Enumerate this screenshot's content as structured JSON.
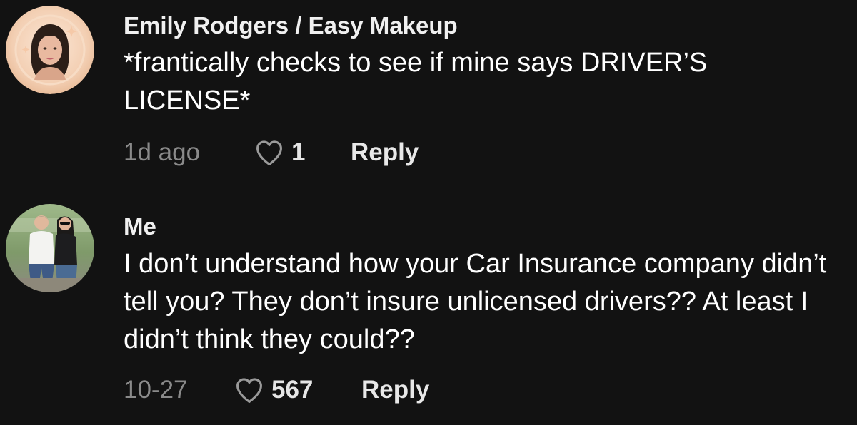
{
  "comments": [
    {
      "username": "Emily Rodgers / Easy Makeup",
      "text": "*frantically checks to see if mine says DRIVER’S LICENSE*",
      "time": "1d ago",
      "likes": "1",
      "reply_label": "Reply",
      "avatar_icon": "woman-portrait-avatar"
    },
    {
      "username": "Me",
      "text": "I don’t understand how your Car Insurance company didn’t tell you? They don’t insure unlicensed drivers?? At least I didn’t think they could??",
      "time": "10-27",
      "likes": "567",
      "reply_label": "Reply",
      "avatar_icon": "couple-photo-avatar"
    }
  ],
  "colors": {
    "background": "#121212",
    "text": "#ffffff",
    "muted": "#8a8a8a"
  }
}
